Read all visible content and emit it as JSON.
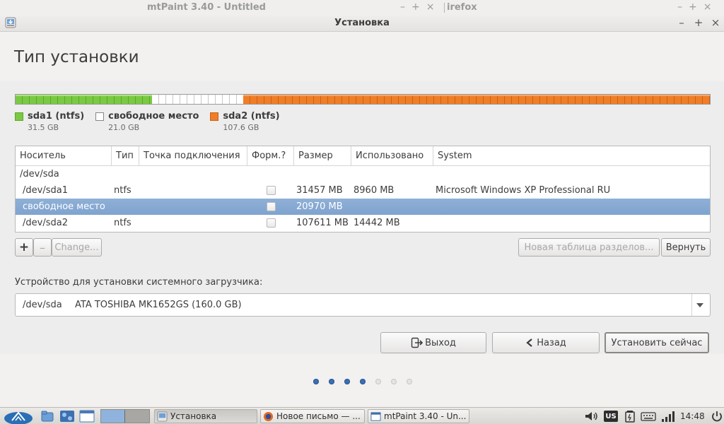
{
  "background_windows": {
    "mtpaint_title": "mtPaint 3.40 - Untitled",
    "firefox_title": "irefox",
    "controls": "–+×"
  },
  "window": {
    "title": "Установка",
    "min": "–",
    "max": "+",
    "close": "×"
  },
  "page": {
    "heading": "Тип установки"
  },
  "partition_bar": {
    "segments": [
      {
        "name": "sda1 (ntfs)",
        "size": "31.5 GB",
        "fraction": 0.197,
        "color": "#7ac943"
      },
      {
        "name": "свободное место",
        "size": "21.0 GB",
        "fraction": 0.131,
        "color": "#ffffff"
      },
      {
        "name": "sda2 (ntfs)",
        "size": "107.6 GB",
        "fraction": 0.672,
        "color": "#f07e27"
      }
    ]
  },
  "table": {
    "headers": [
      "Носитель",
      "Тип",
      "Точка подключения",
      "Форм.?",
      "Размер",
      "Использовано",
      "System"
    ],
    "rows": [
      {
        "device": "/dev/sda",
        "type": "",
        "mount": "",
        "format": "",
        "size": "",
        "used": "",
        "system": ""
      },
      {
        "device": "/dev/sda1",
        "type": "ntfs",
        "mount": "",
        "format": "checkbox",
        "size": "31457 MB",
        "used": "8960 MB",
        "system": "Microsoft Windows XP Professional RU"
      },
      {
        "device": "свободное место",
        "type": "",
        "mount": "",
        "format": "checkbox",
        "size": "20970 MB",
        "used": "",
        "system": "",
        "selected": true
      },
      {
        "device": "/dev/sda2",
        "type": "ntfs",
        "mount": "",
        "format": "checkbox",
        "size": "107611 MB",
        "used": "14442 MB",
        "system": ""
      }
    ]
  },
  "buttons": {
    "add": "+",
    "remove": "–",
    "change": "Change...",
    "new_table": "Новая таблица разделов...",
    "revert": "Вернуть",
    "quit": "Выход",
    "back": "Назад",
    "install": "Установить сейчас"
  },
  "bootloader": {
    "label": "Устройство для установки системного загрузчика:",
    "device": "/dev/sda",
    "model": "ATA TOSHIBA MK1652GS (160.0 GB)"
  },
  "progress": {
    "total_steps": 7,
    "current_step": 4
  },
  "taskbar": {
    "tasks": [
      {
        "label": "Установка",
        "active": true
      },
      {
        "label": "Новое письмо — ...",
        "active": false
      },
      {
        "label": "mtPaint 3.40 - Un...",
        "active": false
      }
    ],
    "keyboard_layout": "US",
    "clock": "14:48"
  },
  "colors": {
    "selection": "#86abd9",
    "progress_dot_active": "#3a6fb3"
  }
}
